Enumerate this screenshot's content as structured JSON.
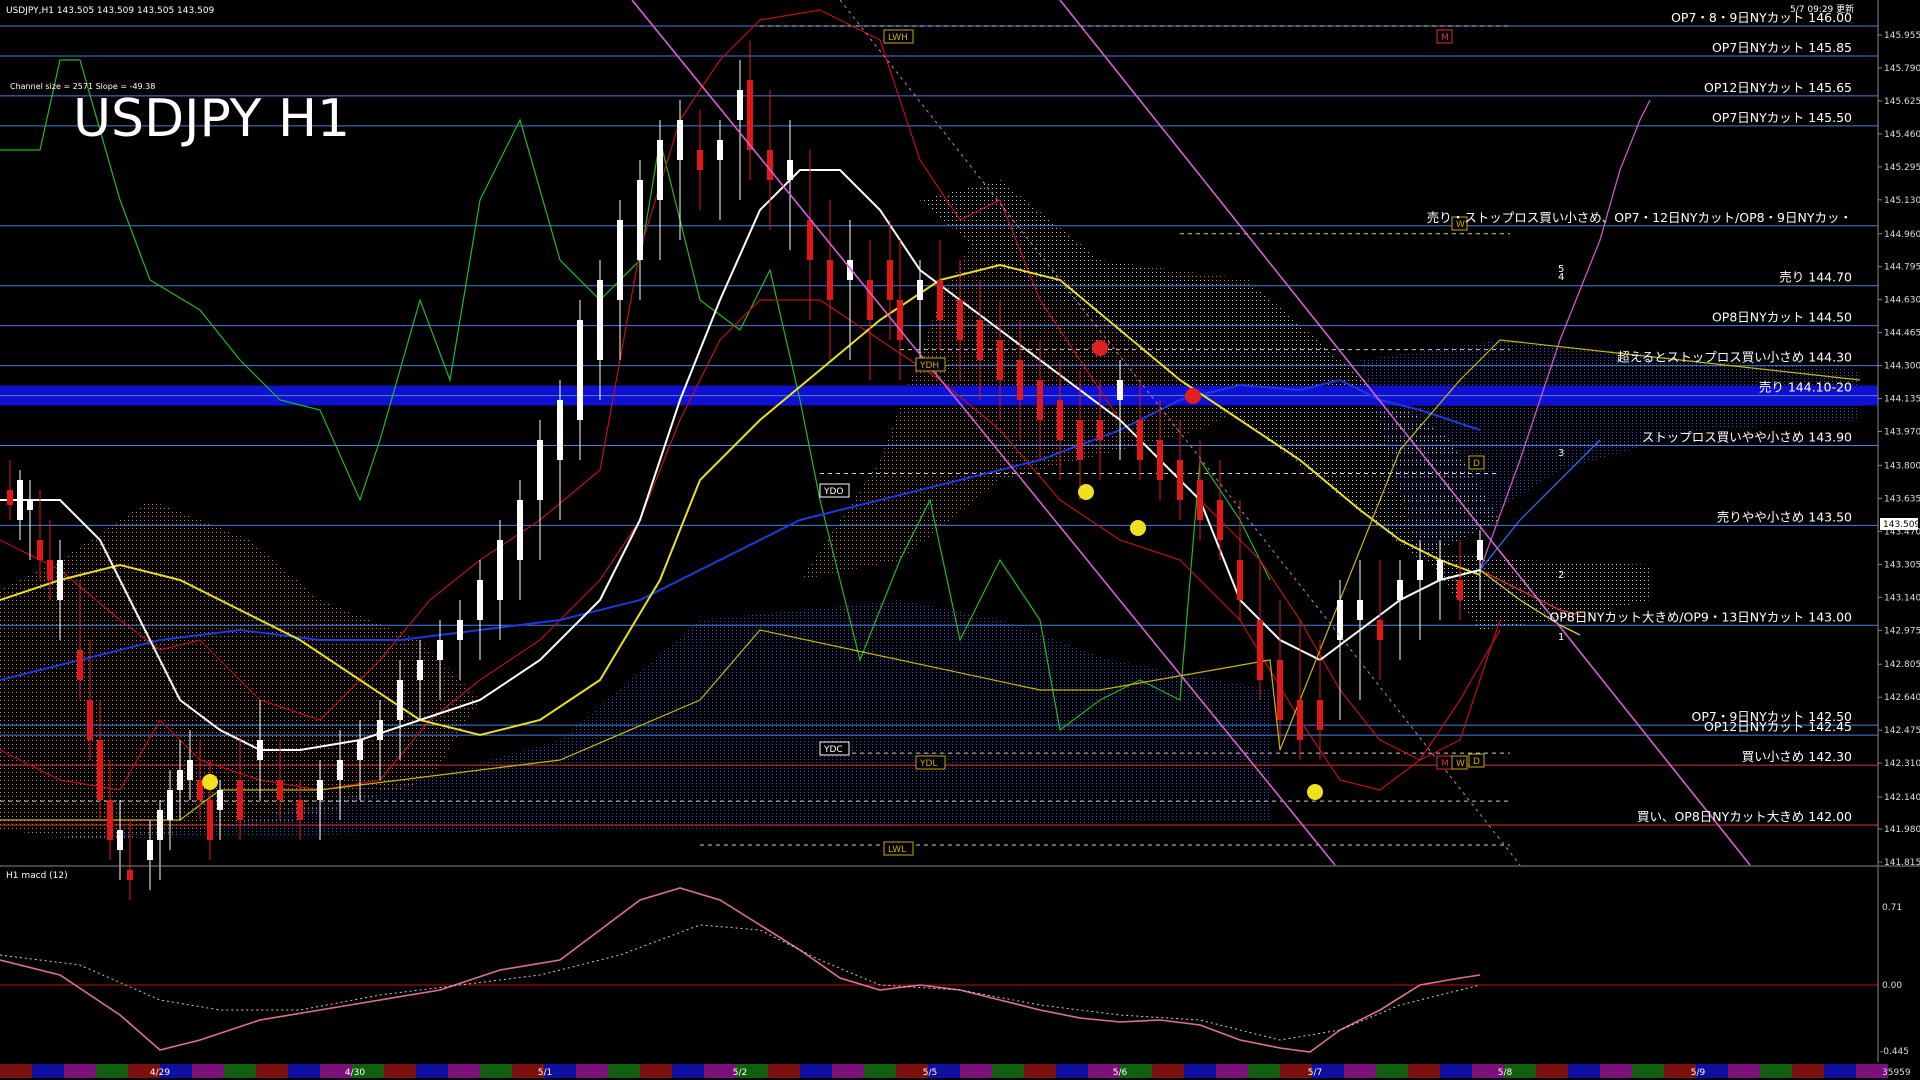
{
  "header": {
    "symbol_line": "USDJPY,H1  143.505 143.509 143.505 143.509",
    "channel_info": "Channel size = 2571 Slope = -49.38",
    "big_title": "USDJPY H1",
    "update_time": "5/7 09:29 更新"
  },
  "price_axis": {
    "labels": [
      "145.955",
      "145.790",
      "145.625",
      "145.460",
      "145.295",
      "145.130",
      "144.960",
      "144.795",
      "144.630",
      "144.465",
      "144.300",
      "144.135",
      "143.970",
      "143.800",
      "143.635",
      "143.470",
      "143.305",
      "143.140",
      "142.975",
      "142.805",
      "142.640",
      "142.475",
      "142.310",
      "142.140",
      "141.980",
      "141.815"
    ],
    "current_price": "143.509"
  },
  "levels": [
    {
      "label": "OP7・8・9日NYカット 146.00",
      "price": 146.0,
      "color": "#4a7de0"
    },
    {
      "label": "OP7日NYカット 145.85",
      "price": 145.85,
      "color": "#4a7de0"
    },
    {
      "label": "OP12日NYカット 145.65",
      "price": 145.65,
      "color": "#4a7de0"
    },
    {
      "label": "OP7日NYカット 145.50",
      "price": 145.5,
      "color": "#4a7de0"
    },
    {
      "label": "売り・ストップロス買い小さめ、OP7・12日NYカット/OP8・9日NYカッ・",
      "price": 145.0,
      "color": "#4a7de0"
    },
    {
      "label": "売り 144.70",
      "price": 144.7,
      "color": "#4a7de0"
    },
    {
      "label": "OP8日NYカット 144.50",
      "price": 144.5,
      "color": "#4a7de0"
    },
    {
      "label": "超えるとストップロス買い小さめ 144.30",
      "price": 144.3,
      "color": "#4a7de0"
    },
    {
      "label": "売り 144.10-20",
      "price": 144.15,
      "color": "#4a7de0"
    },
    {
      "label": "ストップロス買いやや小さめ 143.90",
      "price": 143.9,
      "color": "#4a7de0"
    },
    {
      "label": "売りやや小さめ 143.50",
      "price": 143.5,
      "color": "#4a7de0"
    },
    {
      "label": "OP8日NYカット大きめ/OP9・13日NYカット 143.00",
      "price": 143.0,
      "color": "#4a7de0"
    },
    {
      "label": "OP7・9日NYカット 142.50",
      "price": 142.5,
      "color": "#4a7de0"
    },
    {
      "label": "OP12日NYカット 142.45",
      "price": 142.45,
      "color": "#4a7de0"
    },
    {
      "label": "買い小さめ 142.30",
      "price": 142.3,
      "color": "#e03030"
    },
    {
      "label": "買い、OP8日NYカット大きめ 142.00",
      "price": 142.0,
      "color": "#e03030"
    }
  ],
  "markers": {
    "lwh": "LWH",
    "lwl": "LWL",
    "ydh": "YDH",
    "ydl": "YDL",
    "ydo": "YDO",
    "ydc": "YDC",
    "d_top": "D",
    "d_bot": "D",
    "m_top": "M",
    "m_bot": "M",
    "w_bot": "W",
    "w_mid": "W",
    "wave_labels": [
      "5",
      "4",
      "3",
      "2",
      "1"
    ]
  },
  "macd": {
    "label": "H1  macd (12)",
    "axis_labels": [
      "0.71",
      "0.00",
      "-0.445"
    ]
  },
  "time_axis": {
    "labels": [
      "4/29",
      "4/30",
      "5/1",
      "5/2",
      "5/5",
      "5/6",
      "5/7",
      "5/8",
      "5/9"
    ],
    "corner": "35959"
  },
  "colors": {
    "bg": "#000000",
    "grid_blue": "#2f5cd0",
    "band_blue": "#1010d0",
    "bull": "#ffffff",
    "bear": "#e01818",
    "ma_white": "#ffffff",
    "ma_yellow": "#e8e020",
    "ma_blue": "#1a3ae0",
    "chikou_green": "#22b822",
    "bollinger": "#c01010",
    "channel": "#d860d0",
    "cloud_orange": "#e08040",
    "cloud_blue": "#3050e0"
  }
}
